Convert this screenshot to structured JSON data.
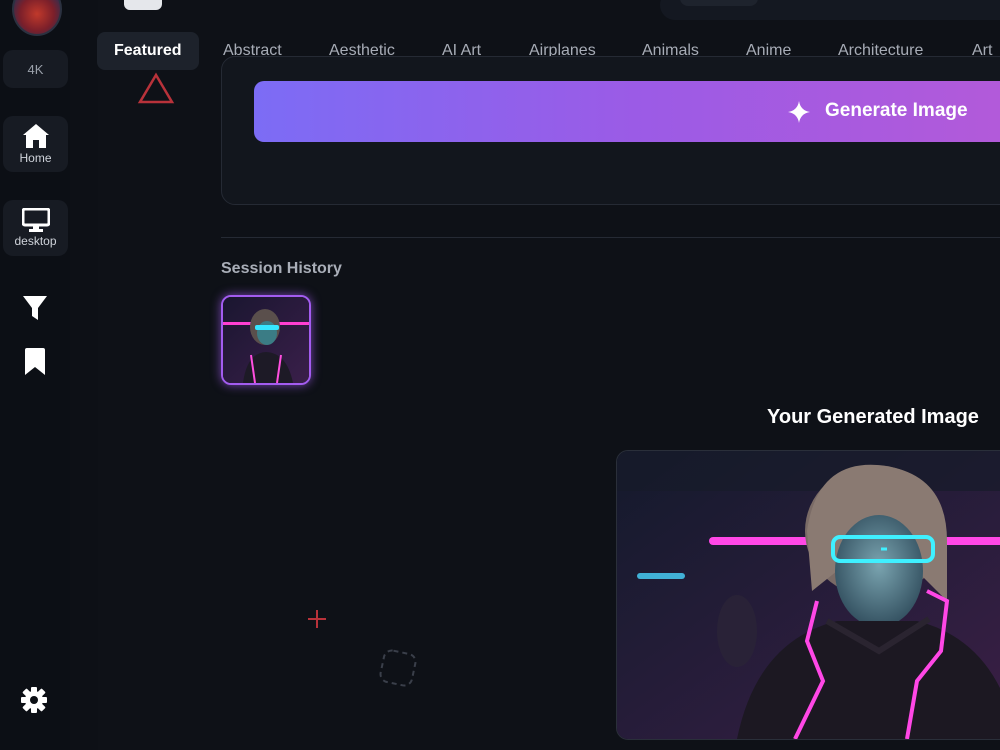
{
  "sidebar": {
    "resolution_label": "4K",
    "home_label": "Home",
    "desktop_label": "desktop",
    "icons": [
      "home-icon",
      "desktop-icon",
      "filter-icon",
      "bookmark-icon",
      "gear-icon"
    ]
  },
  "categories": {
    "active": "Featured",
    "items": [
      "Featured",
      "Abstract",
      "Aesthetic",
      "AI Art",
      "Airplanes",
      "Animals",
      "Anime",
      "Architecture",
      "Art"
    ]
  },
  "generator": {
    "button_label": "Generate Image"
  },
  "history": {
    "title": "Session History"
  },
  "result": {
    "title": "Your Generated Image"
  },
  "colors": {
    "background": "#0e1117",
    "accent_gradient_start": "#7c6cf5",
    "accent_gradient_end": "#b35ad9",
    "thumbnail_border": "#a35cf0",
    "warning_triangle": "#b8323a"
  }
}
